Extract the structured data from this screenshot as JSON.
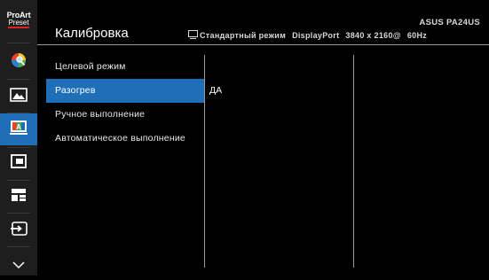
{
  "rail": {
    "logo": {
      "line1": "ProArt",
      "line2": "Preset"
    },
    "items": [
      {
        "icon": "color-wheel-icon"
      },
      {
        "icon": "image-mountain-icon"
      },
      {
        "icon": "calibration-icon",
        "active": true
      },
      {
        "icon": "pip-icon"
      },
      {
        "icon": "qc-grid-icon"
      },
      {
        "icon": "input-select-icon"
      },
      {
        "icon": "chevron-down-icon"
      }
    ]
  },
  "header": {
    "title": "Калибровка",
    "model": "ASUS PA24US",
    "status": {
      "mode": "Стандартный режим",
      "input": "DisplayPort",
      "resolution": "3840 x 2160@",
      "refresh": "60Hz"
    }
  },
  "menu": {
    "items": [
      {
        "label": "Целевой режим"
      },
      {
        "label": "Разогрев",
        "selected": true
      },
      {
        "label": "Ручное выполнение"
      },
      {
        "label": "Автоматическое выполнение"
      }
    ]
  },
  "submenu": {
    "items": [
      {
        "label": "ДА"
      }
    ]
  },
  "colors": {
    "accent": "#1e6fb8",
    "rail_bg": "#1e1e1e",
    "logo_underline": "#d9261c",
    "divider": "#9a9a9a"
  }
}
